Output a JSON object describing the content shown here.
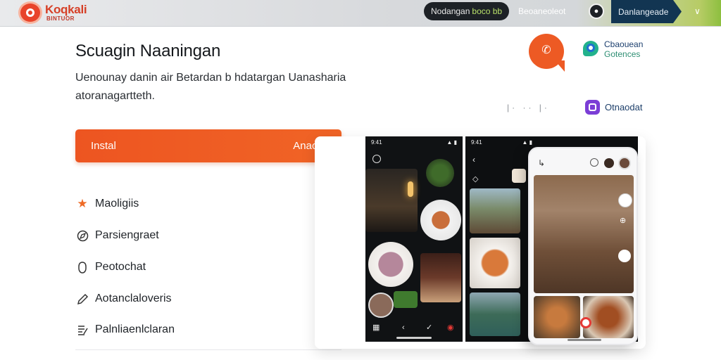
{
  "header": {
    "brand": "Koqkali",
    "brand_sub": "BINTUOR",
    "pill_text": "Nodangan",
    "pill_accent": "boco bb",
    "nav_link": "Beoaneoleot",
    "cta": "Danlangeade",
    "menu_icon": "chevron-down-icon",
    "logo_color": "#e8442a"
  },
  "main": {
    "title": "Scuagin Naaningan",
    "description_line1": "Uenounay danin air Betardan b hdatargan Uanasharia",
    "description_line2": "atoranagartteth.",
    "install_label": "Instal",
    "install_secondary": "Anaoal",
    "accent_color": "#ee5a22"
  },
  "features": [
    {
      "label": "Maoligiis",
      "icon": "star-icon"
    },
    {
      "label": "Parsiengraet",
      "icon": "compass-icon"
    },
    {
      "label": "Peotochat",
      "icon": "shield-icon"
    },
    {
      "label": "Aotanclaloveris",
      "icon": "pencil-icon"
    },
    {
      "label": "Palnliaenlclaran",
      "icon": "document-icon"
    }
  ],
  "side": {
    "label1_line1": "Cbaouean",
    "label1_line2": "Gotences",
    "label2": "Otnaodat"
  },
  "screens": {
    "phone1_time": "9:41",
    "phone2_time": "9:41"
  }
}
